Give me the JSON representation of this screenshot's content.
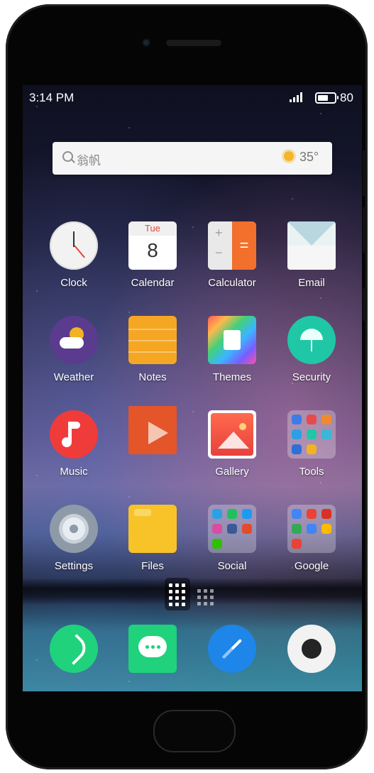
{
  "status_bar": {
    "time": "3:14 PM",
    "battery_percent": "80",
    "battery_level": 0.8,
    "signal_bars": 4
  },
  "search_widget": {
    "query": "翁帆",
    "weather_icon": "sun-icon",
    "temperature": "35°"
  },
  "apps": [
    {
      "label": "Clock",
      "icon": "clock-icon"
    },
    {
      "label": "Calendar",
      "icon": "calendar-icon",
      "calendar_day": "Tue",
      "calendar_date": "8"
    },
    {
      "label": "Calculator",
      "icon": "calculator-icon",
      "symbols": [
        "+",
        "−",
        "="
      ]
    },
    {
      "label": "Email",
      "icon": "envelope-icon"
    },
    {
      "label": "Weather",
      "icon": "weather-icon"
    },
    {
      "label": "Notes",
      "icon": "notes-icon"
    },
    {
      "label": "Themes",
      "icon": "themes-icon"
    },
    {
      "label": "Security",
      "icon": "umbrella-icon"
    },
    {
      "label": "Music",
      "icon": "music-note-icon"
    },
    {
      "label": "",
      "icon": "video-play-icon"
    },
    {
      "label": "Gallery",
      "icon": "gallery-icon"
    },
    {
      "label": "Tools",
      "icon": "folder-icon"
    },
    {
      "label": "Settings",
      "icon": "gear-icon"
    },
    {
      "label": "Files",
      "icon": "files-folder-icon"
    },
    {
      "label": "Social",
      "icon": "folder-icon"
    },
    {
      "label": "Google",
      "icon": "folder-icon"
    }
  ],
  "dock": [
    {
      "icon": "phone-icon"
    },
    {
      "icon": "messages-icon"
    },
    {
      "icon": "browser-compass-icon"
    },
    {
      "icon": "camera-icon"
    }
  ],
  "colors": {
    "accent_red": "#e24a3a",
    "sun": "#f3b52a",
    "security_teal": "#1fc7a6",
    "dock_green": "#1fd27b",
    "browser_blue": "#1d86e8"
  }
}
